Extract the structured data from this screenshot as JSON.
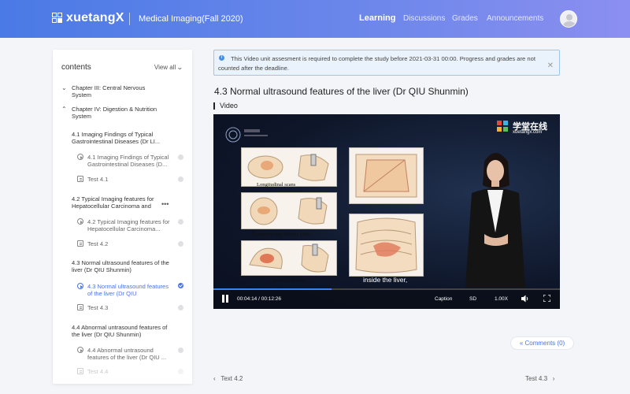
{
  "header": {
    "logo_text": "xuetangX",
    "course_title": "Medical Imaging(Fall 2020)",
    "nav": [
      {
        "label": "Learning",
        "active": true
      },
      {
        "label": "Discussions",
        "active": false
      },
      {
        "label": "Grades",
        "active": false
      },
      {
        "label": "Announcements",
        "active": false
      }
    ],
    "avatar_icon": "user-avatar-icon"
  },
  "sidebar": {
    "title": "contents",
    "view_all": "View all",
    "chapters": [
      {
        "label": "Chapter III: Central Nervous System",
        "expanded": false
      },
      {
        "label": "Chapter IV: Digestion & Nutrition System",
        "expanded": true
      }
    ],
    "sections": [
      {
        "label": "4.1 Imaging Findings of Typical Gastrointestinal Diseases (Dr LI...",
        "items": [
          {
            "type": "video",
            "label": "4.1 Imaging Findings of Typical Gastrointestinal Diseases (D...",
            "done": false
          },
          {
            "type": "test",
            "label": "Test 4.1",
            "done": false
          }
        ]
      },
      {
        "label": "4.2 Typical Imaging features for Hepatocellular Carcinoma and",
        "items": [
          {
            "type": "video",
            "label": "4.2 Typical Imaging features for Hepatocellular Carcinoma...",
            "done": false
          },
          {
            "type": "test",
            "label": "Test 4.2",
            "done": false
          }
        ]
      },
      {
        "label": "4.3 Normal ultrasound features of the liver (Dr QIU Shunmin)",
        "items": [
          {
            "type": "video",
            "label": "4.3 Normal ultrasound features of the liver (Dr QIU",
            "done": true,
            "active": true
          },
          {
            "type": "test",
            "label": "Test 4.3",
            "done": false
          }
        ]
      },
      {
        "label": "4.4 Abnormal untrasound features of the liver (Dr QIU Shunmin)",
        "items": [
          {
            "type": "video",
            "label": "4.4 Abnormal untrasound features of the liver (Dr QIU ...",
            "done": false
          },
          {
            "type": "test",
            "label": "Test 4.4",
            "done": false
          }
        ]
      }
    ]
  },
  "notice": {
    "text": "This Video unit assesment is required to complete the study before 2021-03-31 00:00. Progress and grades are not counted after the deadline.",
    "close_icon": "close-icon"
  },
  "main": {
    "unit_title": "4.3 Normal ultrasound features of the liver (Dr QIU Shunmin)",
    "video_label": "Video"
  },
  "video": {
    "logo_cn": "学堂在线",
    "logo_en": "xuetangx.com",
    "slide_labels": [
      "Longitudinal scans",
      "Transverse and oblique scans",
      "Intercostal scans"
    ],
    "subtitle": "inside the liver,",
    "time": "00:04:14 / 00:12:26",
    "progress": 0.34,
    "caption_label": "Caption",
    "quality_label": "SD",
    "speed_label": "1.00X"
  },
  "comments": {
    "label": "Comments (0)"
  },
  "pager": {
    "prev_label": "Text 4.2",
    "next_label": "Test 4.3"
  }
}
